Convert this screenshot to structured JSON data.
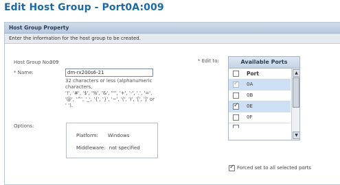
{
  "page": {
    "title": "Edit Host Group - Port0A:009"
  },
  "panel": {
    "header": "Host Group Property",
    "instruction": "Enter the information for the host group to be created."
  },
  "form": {
    "host_group_no_label": "Host Group No.:",
    "host_group_no_value": "009",
    "name_label": "* Name:",
    "name_value": "dm-rx200s6-21",
    "name_hint_1": "32 characters or less (alphanumeric",
    "name_hint_2": "characters,",
    "name_hint_3": "'!', '#', '$', '%', '&', '''', '+', '-', '.', '=',",
    "name_hint_4": "'@', '^', '_', '{', '}', '~', '(', ')', '[', ']' or",
    "name_hint_5": "' ').",
    "options_label": "Options:",
    "platform_label": "Platform:",
    "platform_value": "Windows",
    "middleware_label": "Middleware:",
    "middleware_value": "not specified",
    "edit_to_label": "* Edit to:"
  },
  "ports": {
    "header": "Available Ports",
    "column": "Port",
    "items": [
      {
        "label": "0A",
        "checked": true,
        "disabled": true,
        "selected": true
      },
      {
        "label": "0B",
        "checked": false,
        "disabled": false,
        "selected": false
      },
      {
        "label": "0E",
        "checked": true,
        "disabled": false,
        "selected": true
      },
      {
        "label": "0F",
        "checked": false,
        "disabled": false,
        "selected": false
      }
    ]
  },
  "forced": {
    "label": "Forced set to all selected ports",
    "checked": true
  }
}
